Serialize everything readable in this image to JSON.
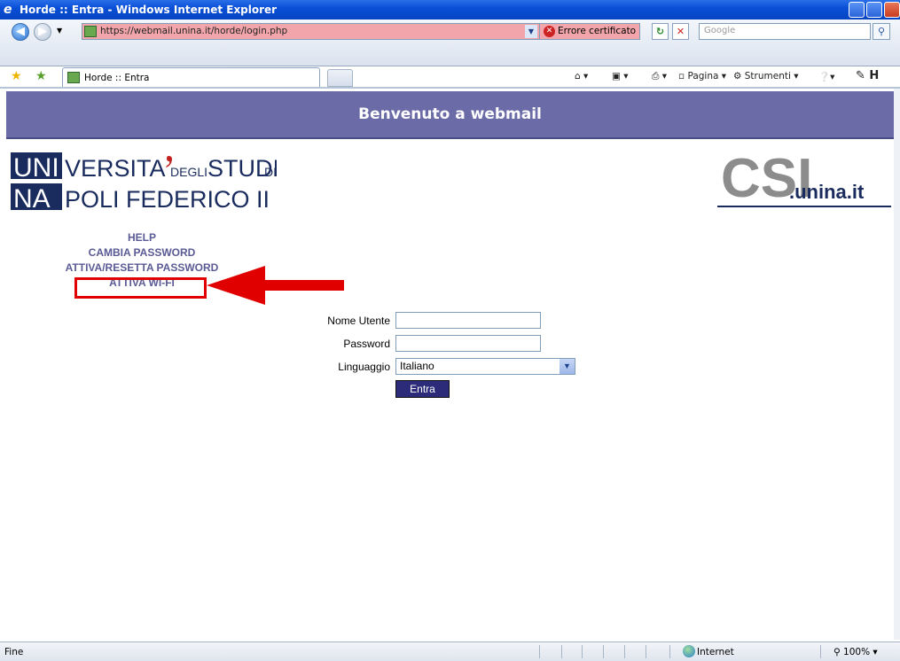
{
  "window": {
    "title": "Horde :: Entra - Windows Internet Explorer"
  },
  "address_bar": {
    "url": "https://webmail.unina.it/horde/login.php",
    "cert_error": "Errore certificato",
    "search_placeholder": "Google"
  },
  "tab": {
    "title": "Horde :: Entra"
  },
  "command_bar": {
    "page": "Pagina",
    "tools": "Strumenti"
  },
  "banner": {
    "text": "Benvenuto a webmail"
  },
  "logo_left": {
    "line1_a": "UNI",
    "line1_b": "VERSITA",
    "line1_c": "DEGLI",
    "line1_d": "STUDI",
    "line1_e": "DI",
    "line2_a": "NA",
    "line2_b": "POLI FEDERICO II"
  },
  "logo_right": {
    "csi": "CSI",
    "domain": ".unina.it"
  },
  "menu": [
    "HELP",
    "CAMBIA PASSWORD",
    "ATTIVA/RESETTA PASSWORD",
    "ATTIVA WI-FI"
  ],
  "form": {
    "username_label": "Nome Utente",
    "username_value": "",
    "password_label": "Password",
    "password_value": "",
    "language_label": "Linguaggio",
    "language_value": "Italiano",
    "submit_label": "Entra"
  },
  "status_bar": {
    "left": "Fine",
    "zone": "Internet",
    "zoom": "100%"
  },
  "colors": {
    "banner": "#6b6ba8",
    "highlight": "#e00000",
    "menu": "#5a5a95",
    "submit": "#2b2b7a"
  }
}
